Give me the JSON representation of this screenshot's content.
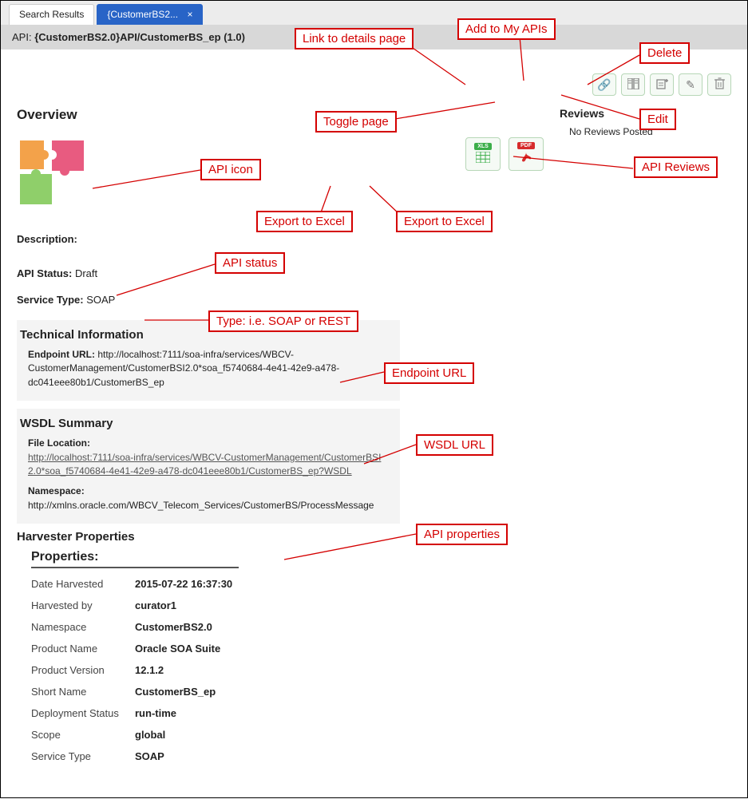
{
  "tabs": {
    "search": "Search Results",
    "activeTab": "{CustomerBS2...",
    "close_x": "×"
  },
  "apiBar": {
    "label": "API:",
    "name": "{CustomerBS2.0}API/CustomerBS_ep",
    "version": "(1.0)"
  },
  "overview": {
    "heading": "Overview",
    "description_label": "Description:",
    "api_status_label": "API Status:",
    "api_status_value": "Draft",
    "service_type_label": "Service Type:",
    "service_type_value": "SOAP",
    "export_xls_label": "XLS",
    "export_pdf_label": "PDF"
  },
  "reviews": {
    "heading": "Reviews",
    "none": "No Reviews Posted"
  },
  "technical": {
    "heading": "Technical Information",
    "endpoint_label": "Endpoint URL:",
    "endpoint_value": "http://localhost:7111/soa-infra/services/WBCV-CustomerManagement/CustomerBSI2.0*soa_f5740684-4e41-42e9-a478-dc041eee80b1/CustomerBS_ep"
  },
  "wsdl": {
    "heading": "WSDL Summary",
    "file_loc_label": "File Location:",
    "file_loc_value": "http://localhost:7111/soa-infra/services/WBCV-CustomerManagement/CustomerBSI2.0*soa_f5740684-4e41-42e9-a478-dc041eee80b1/CustomerBS_ep?WSDL",
    "namespace_label": "Namespace:",
    "namespace_value": "http://xmlns.oracle.com/WBCV_Telecom_Services/CustomerBS/ProcessMessage"
  },
  "harvester": {
    "heading": "Harvester Properties",
    "props_title": "Properties:",
    "rows": [
      {
        "k": "Date Harvested",
        "v": "2015-07-22 16:37:30"
      },
      {
        "k": "Harvested by",
        "v": "curator1"
      },
      {
        "k": "Namespace",
        "v": "CustomerBS2.0"
      },
      {
        "k": "Product Name",
        "v": "Oracle SOA Suite"
      },
      {
        "k": "Product Version",
        "v": "12.1.2"
      },
      {
        "k": "Short Name",
        "v": "CustomerBS_ep"
      },
      {
        "k": "Deployment Status",
        "v": "run-time"
      },
      {
        "k": "Scope",
        "v": "global"
      },
      {
        "k": "Service Type",
        "v": "SOAP"
      }
    ]
  },
  "callouts": {
    "link_details": "Link to details page",
    "add_my_apis": "Add to My APIs",
    "delete": "Delete",
    "edit": "Edit",
    "toggle_page": "Toggle page",
    "api_reviews": "API Reviews",
    "api_icon": "API icon",
    "export_excel1": "Export to Excel",
    "export_excel2": "Export to Excel",
    "api_status": "API status",
    "type_soap": "Type: i.e. SOAP or REST",
    "endpoint_url": "Endpoint URL",
    "wsdl_url": "WSDL URL",
    "api_properties": "API properties"
  }
}
